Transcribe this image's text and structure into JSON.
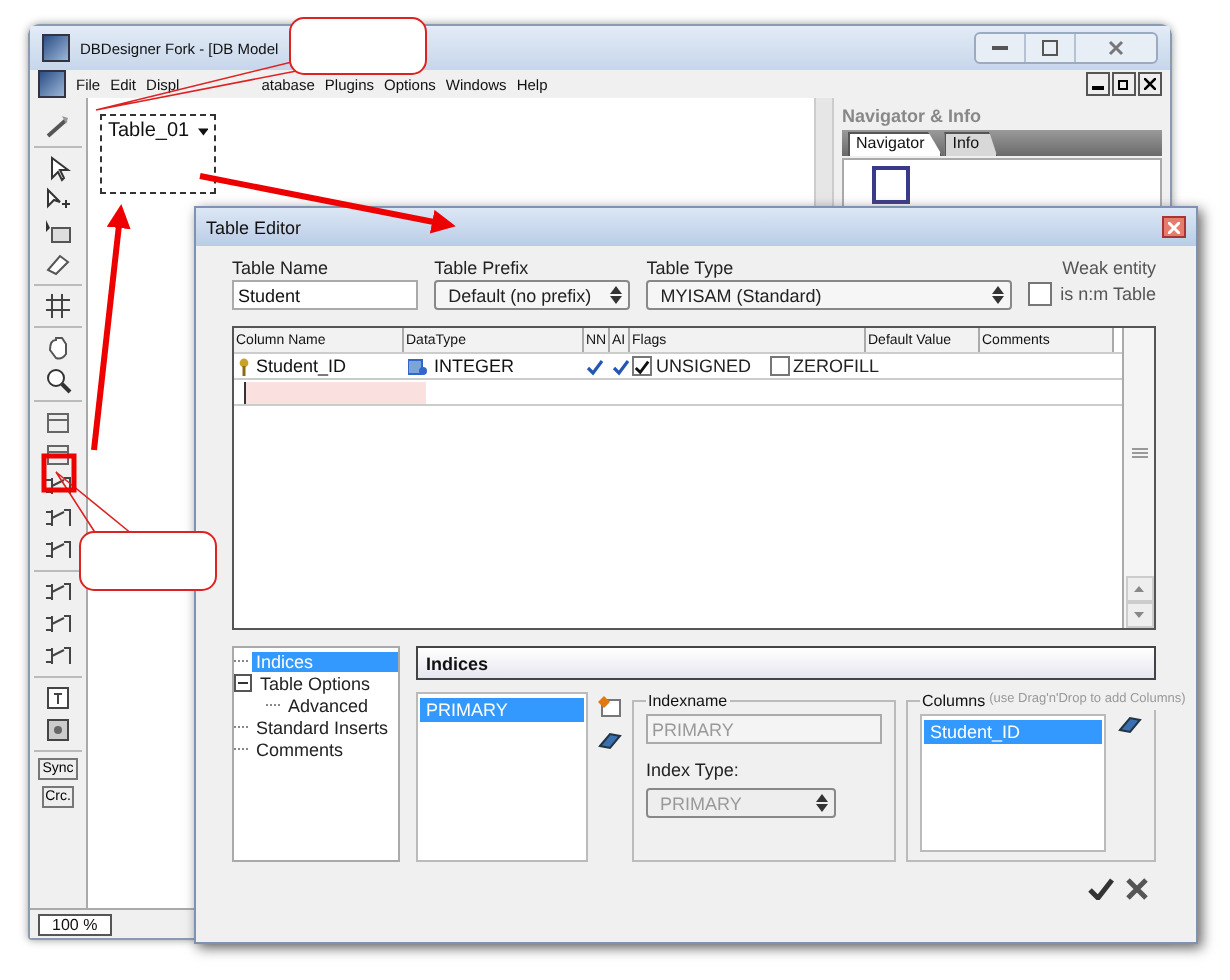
{
  "window": {
    "title": "DBDesigner Fork - [DB Model"
  },
  "menu": [
    {
      "label": "File"
    },
    {
      "label": "Edit"
    },
    {
      "label": "Displ"
    },
    {
      "label": "atabase"
    },
    {
      "label": "Plugins"
    },
    {
      "label": "Options"
    },
    {
      "label": "Windows"
    },
    {
      "label": "Help"
    }
  ],
  "toolbar": {
    "text_tools": [
      "Sync",
      "Crc."
    ]
  },
  "canvas": {
    "table": {
      "name": "Table_01"
    }
  },
  "status_bar": {
    "zoom": "100 %"
  },
  "navigator": {
    "title": "Navigator & Info",
    "tabs": [
      {
        "label": "Navigator",
        "selected": true
      },
      {
        "label": "Info",
        "selected": false
      }
    ]
  },
  "editor": {
    "title": "Table Editor",
    "table_name": {
      "label": "Table Name",
      "value": "Student"
    },
    "table_prefix": {
      "label": "Table Prefix",
      "value": "Default (no prefix)"
    },
    "table_type": {
      "label": "Table Type",
      "value": "MYISAM  (Standard)"
    },
    "weak_entity": {
      "label": "Weak entity",
      "checkbox_label": "is n:m Table",
      "checked": false
    },
    "columns": [
      "Column Name",
      "DataType",
      "NN",
      "AI",
      "Flags",
      "Default Value",
      "Comments"
    ],
    "rows": [
      {
        "name": "Student_ID",
        "primary_key": true,
        "datatype": "INTEGER",
        "nn": true,
        "ai": true,
        "flags": [
          {
            "label": "UNSIGNED",
            "checked": true
          },
          {
            "label": "ZEROFILL",
            "checked": false
          }
        ]
      }
    ],
    "tree": [
      {
        "label": "Indices",
        "selected": true
      },
      {
        "label": "Table Options",
        "selected": false,
        "expanded": true,
        "children": [
          {
            "label": "Advanced",
            "selected": false
          }
        ]
      },
      {
        "label": "Standard Inserts",
        "selected": false
      },
      {
        "label": "Comments",
        "selected": false
      }
    ],
    "section_title": "Indices",
    "indices": [
      {
        "label": "PRIMARY",
        "selected": true
      }
    ],
    "indexname": {
      "label": "Indexname",
      "value": "PRIMARY"
    },
    "index_type": {
      "label": "Index Type:",
      "value": "PRIMARY"
    },
    "index_columns": {
      "label": "Columns",
      "hint": "(use Drag'n'Drop to add Columns)",
      "items": [
        {
          "label": "Student_ID",
          "selected": true
        }
      ]
    }
  }
}
